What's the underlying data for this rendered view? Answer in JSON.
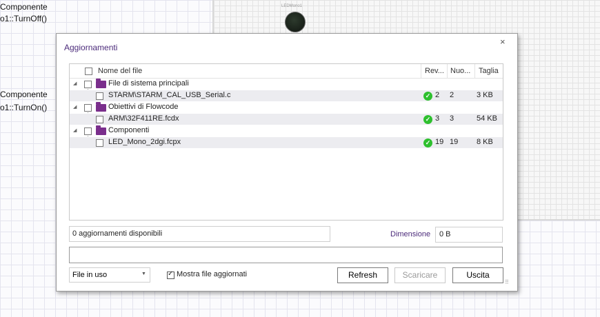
{
  "background": {
    "code_lines": [
      "Componente",
      "o1::TurnOff()",
      "Componente",
      "o1::TurnOn()"
    ],
    "led_label": "LEDMono1"
  },
  "dialog": {
    "title": "Aggiornamenti",
    "close_glyph": "×",
    "columns": [
      "Nome del file",
      "Rev...",
      "Nuo...",
      "Taglia"
    ],
    "groups": [
      {
        "label": "File di sistema principali",
        "files": [
          {
            "name": "STARM\\STARM_CAL_USB_Serial.c",
            "rev": "2",
            "new": "2",
            "size": "3 KB"
          }
        ]
      },
      {
        "label": "Obiettivi di Flowcode",
        "files": [
          {
            "name": "ARM\\32F411RE.fcdx",
            "rev": "3",
            "new": "3",
            "size": "54 KB"
          }
        ]
      },
      {
        "label": "Componenti",
        "files": [
          {
            "name": "LED_Mono_2dgi.fcpx",
            "rev": "19",
            "new": "19",
            "size": "8 KB"
          }
        ]
      }
    ],
    "status_text": "0 aggiornamenti disponibili",
    "size_label": "Dimensione",
    "size_value": "0 B",
    "progress_text": "",
    "dropdown_value": "File in uso",
    "show_updated_label": "Mostra file aggiornati",
    "show_updated_checked": true,
    "buttons": {
      "refresh": "Refresh",
      "download": "Scaricare",
      "exit": "Uscita"
    }
  },
  "colors": {
    "accent": "#4b2a7a",
    "folder": "#7a2e8c",
    "ok": "#2ec02e"
  }
}
